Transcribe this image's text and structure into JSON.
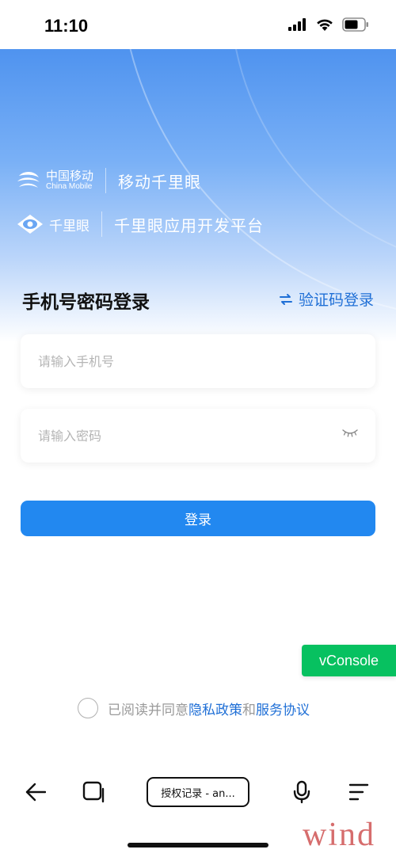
{
  "status_bar": {
    "time": "11:10",
    "icons": [
      "cellular-signal-icon",
      "wifi-icon",
      "battery-icon"
    ]
  },
  "brand": {
    "company_cn": "中国移动",
    "company_en": "China Mobile",
    "product": "移动千里眼",
    "platform_logo_text": "千里眼",
    "platform_name": "千里眼应用开发平台"
  },
  "login": {
    "title": "手机号密码登录",
    "switch_label": "验证码登录",
    "phone_placeholder": "请输入手机号",
    "phone_value": "",
    "password_placeholder": "请输入密码",
    "password_value": "",
    "submit_label": "登录"
  },
  "vconsole": {
    "label": "vConsole"
  },
  "agreement": {
    "prefix": "已阅读并同意",
    "privacy_link": "隐私政策",
    "conjunction": "和",
    "service_link": "服务协议",
    "checked": false
  },
  "browser_toolbar": {
    "tab_label": "授权记录 - an...",
    "icons": [
      "back-arrow-icon",
      "tabs-icon",
      "microphone-icon",
      "menu-icon"
    ]
  },
  "watermark": "wind",
  "colors": {
    "primary": "#2288f0",
    "link": "#1f6fd6",
    "vconsole_green": "#07c160",
    "hero_top": "#4f93ef"
  }
}
